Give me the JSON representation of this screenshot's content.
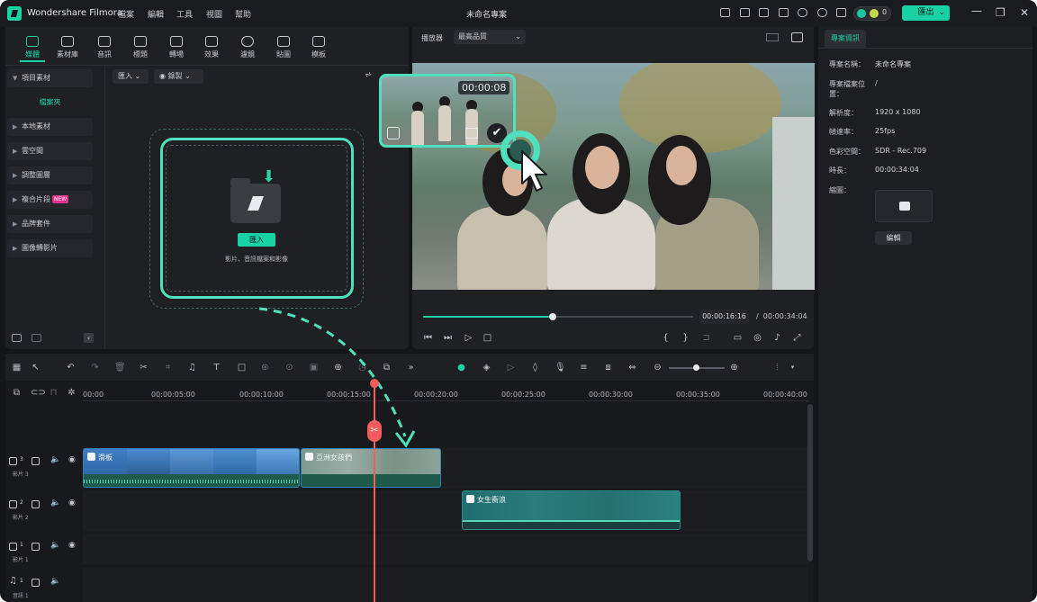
{
  "titlebar": {
    "app_name": "Wondershare Filmora",
    "menus": [
      "檔案",
      "編輯",
      "工具",
      "視圖",
      "幫助"
    ],
    "window_title": "未命名專案",
    "credit_count": "0",
    "export_label": "匯出"
  },
  "media_toolbar": {
    "items": [
      {
        "label": "媒體",
        "icon": "media-icon"
      },
      {
        "label": "素材庫",
        "icon": "stock-icon"
      },
      {
        "label": "音訊",
        "icon": "audio-icon"
      },
      {
        "label": "標題",
        "icon": "title-icon"
      },
      {
        "label": "轉場",
        "icon": "transition-icon"
      },
      {
        "label": "效果",
        "icon": "effects-icon"
      },
      {
        "label": "濾鏡",
        "icon": "filters-icon"
      },
      {
        "label": "貼圖",
        "icon": "stickers-icon"
      },
      {
        "label": "模板",
        "icon": "templates-icon"
      }
    ],
    "active_index": 0
  },
  "sidebar": {
    "items": [
      {
        "label": "項目素材"
      },
      {
        "label": "檔案夾",
        "sub": true
      },
      {
        "label": "本地素材"
      },
      {
        "label": "雲空間"
      },
      {
        "label": "調整圖層"
      },
      {
        "label": "複合片段",
        "badge": "NEW"
      },
      {
        "label": "品牌套件"
      },
      {
        "label": "圖像轉影片"
      }
    ]
  },
  "media_area": {
    "import_dropdown": "匯入",
    "record_dropdown": "錄製",
    "import_button": "匯入",
    "drop_hint": "影片、音訊檔案和影像"
  },
  "preview": {
    "player_label": "播放器",
    "quality": "最高品質",
    "clip_popup_timecode": "00:00:08",
    "current_time": "00:00:16:16",
    "separator": "/",
    "total_time": "00:00:34:04",
    "progress": 0.48
  },
  "properties": {
    "tab": "專案資訊",
    "rows": [
      {
        "label": "專案名稱：",
        "value": "未命名專案"
      },
      {
        "label": "專案檔案位置：",
        "value": "/"
      },
      {
        "label": "解析度：",
        "value": "1920 x 1080"
      },
      {
        "label": "幀速率：",
        "value": "25fps"
      },
      {
        "label": "色彩空間：",
        "value": "SDR - Rec.709"
      },
      {
        "label": "時長：",
        "value": "00:00:34:04"
      },
      {
        "label": "縮圖：",
        "value": ""
      }
    ],
    "edit_button": "編輯"
  },
  "timeline": {
    "ruler": [
      "00:00",
      "00:00:05:00",
      "00:00:10:00",
      "00:00:15:00",
      "00:00:20:00",
      "00:00:25:00",
      "00:00:30:00",
      "00:00:35:00",
      "00:00:40:00"
    ],
    "tracks": [
      {
        "name": "影片 3",
        "index": "3"
      },
      {
        "name": "影片 2",
        "index": "2"
      },
      {
        "name": "影片 1",
        "index": "1"
      },
      {
        "name": "音訊 1",
        "index": "1"
      }
    ],
    "clips": [
      {
        "label": "滑板",
        "track": "影片 3"
      },
      {
        "label": "亞洲女孩們",
        "track": "影片 3"
      },
      {
        "label": "女生衝浪",
        "track": "影片 2"
      }
    ],
    "playhead_time": "00:00:16:16"
  },
  "colors": {
    "accent": "#18d1a5",
    "playhead": "#f25c5c",
    "highlight_outline": "#4fe0be",
    "background": "#141518"
  }
}
